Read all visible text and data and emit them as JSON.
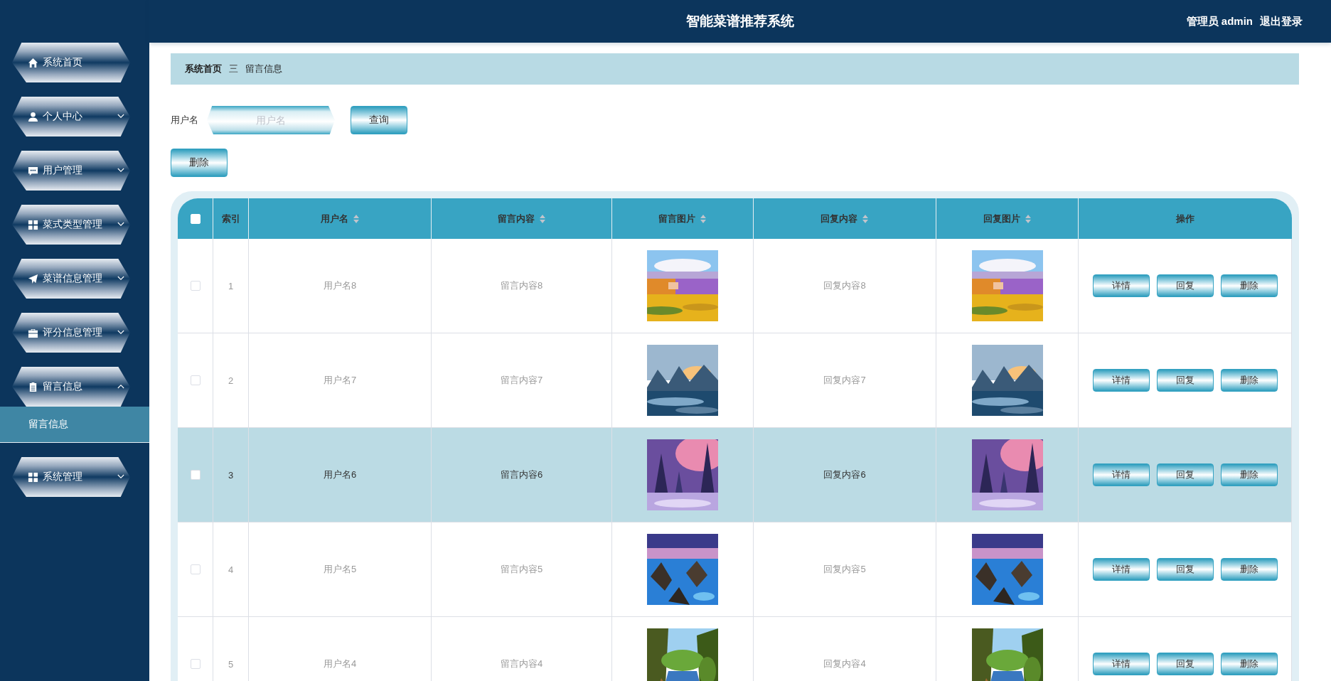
{
  "header": {
    "title": "智能菜谱推荐系统",
    "user_role": "管理员",
    "user_name": "admin",
    "logout": "退出登录"
  },
  "sidebar": {
    "items": [
      {
        "kind": "link",
        "label": "系统首页"
      },
      {
        "kind": "menu",
        "label": "个人中心",
        "expanded": false
      },
      {
        "kind": "menu",
        "label": "用户管理",
        "expanded": false
      },
      {
        "kind": "menu",
        "label": "菜式类型管理",
        "expanded": false
      },
      {
        "kind": "menu",
        "label": "菜谱信息管理",
        "expanded": false
      },
      {
        "kind": "menu",
        "label": "评分信息管理",
        "expanded": false
      },
      {
        "kind": "menu",
        "label": "留言信息",
        "expanded": true,
        "children": [
          {
            "label": "留言信息",
            "selected": true
          }
        ]
      },
      {
        "kind": "menu",
        "label": "系统管理",
        "expanded": false
      }
    ]
  },
  "breadcrumb": {
    "items": [
      "系统首页",
      "留言信息"
    ],
    "separator": "三"
  },
  "search": {
    "label": "用户名",
    "placeholder": "用户名",
    "button": "查询"
  },
  "delete_button": "删除",
  "table": {
    "select_all_checked": false,
    "columns": [
      {
        "label": "索引",
        "sortable": false
      },
      {
        "label": "用户名",
        "sortable": true
      },
      {
        "label": "留言内容",
        "sortable": true
      },
      {
        "label": "留言图片",
        "sortable": true
      },
      {
        "label": "回复内容",
        "sortable": true
      },
      {
        "label": "回复图片",
        "sortable": true
      },
      {
        "label": "操作",
        "sortable": false
      }
    ],
    "rows": [
      {
        "index": "1",
        "username": "用户名8",
        "message": "留言内容8",
        "reply": "回复内容8",
        "checked": false,
        "selected": false,
        "actions": [
          "详情",
          "回复",
          "删除"
        ]
      },
      {
        "index": "2",
        "username": "用户名7",
        "message": "留言内容7",
        "reply": "回复内容7",
        "checked": false,
        "selected": false,
        "actions": [
          "详情",
          "回复",
          "删除"
        ]
      },
      {
        "index": "3",
        "username": "用户名6",
        "message": "留言内容6",
        "reply": "回复内容6",
        "checked": false,
        "selected": true,
        "actions": [
          "详情",
          "回复",
          "删除"
        ]
      },
      {
        "index": "4",
        "username": "用户名5",
        "message": "留言内容5",
        "reply": "回复内容5",
        "checked": false,
        "selected": false,
        "actions": [
          "详情",
          "回复",
          "删除"
        ]
      },
      {
        "index": "5",
        "username": "用户名4",
        "message": "留言内容4",
        "reply": "回复内容4",
        "checked": false,
        "selected": false,
        "actions": [
          "详情",
          "回复",
          "删除"
        ]
      }
    ]
  }
}
